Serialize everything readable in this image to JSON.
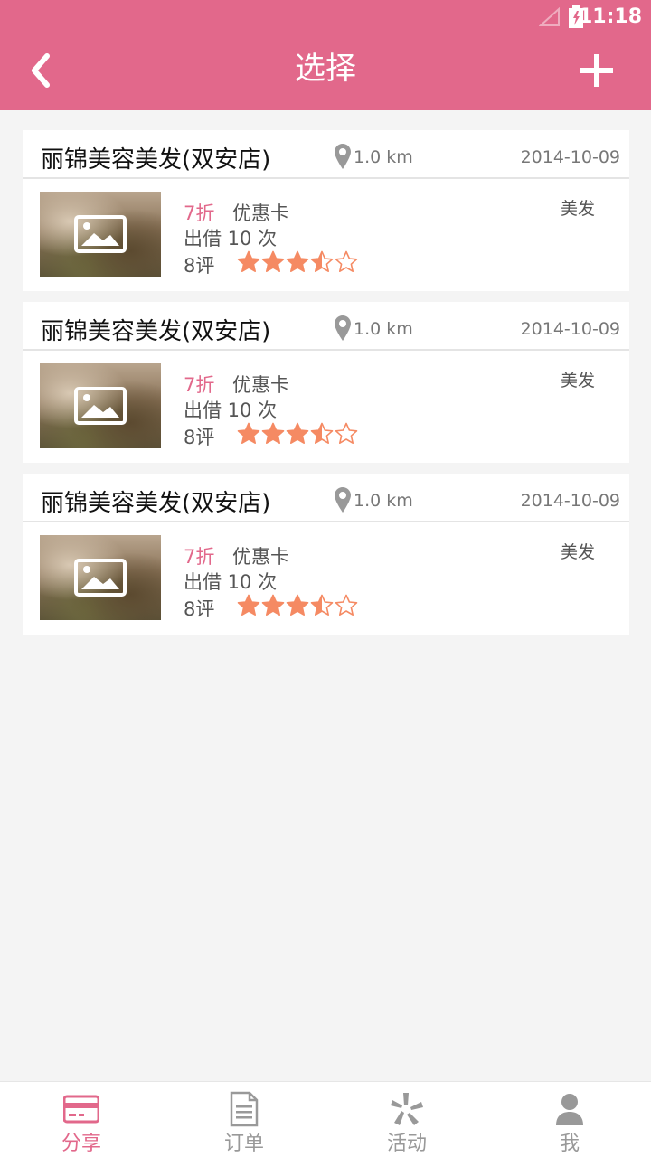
{
  "status": {
    "time": "11:18"
  },
  "header": {
    "title": "选择"
  },
  "colors": {
    "accent": "#e2688b",
    "star": "#f58a63"
  },
  "cards": [
    {
      "name": "丽锦美容美发(双安店)",
      "distance": "1.0 km",
      "date": "2014-10-09",
      "discount": "7折",
      "card_type": "优惠卡",
      "lend": "出借 10 次",
      "reviews": "8评",
      "rating": 3.5,
      "category": "美发"
    },
    {
      "name": "丽锦美容美发(双安店)",
      "distance": "1.0 km",
      "date": "2014-10-09",
      "discount": "7折",
      "card_type": "优惠卡",
      "lend": "出借 10 次",
      "reviews": "8评",
      "rating": 3.5,
      "category": "美发"
    },
    {
      "name": "丽锦美容美发(双安店)",
      "distance": "1.0 km",
      "date": "2014-10-09",
      "discount": "7折",
      "card_type": "优惠卡",
      "lend": "出借 10 次",
      "reviews": "8评",
      "rating": 3.5,
      "category": "美发"
    }
  ],
  "nav": [
    {
      "label": "分享",
      "icon": "card-icon",
      "active": true
    },
    {
      "label": "订单",
      "icon": "document-icon",
      "active": false
    },
    {
      "label": "活动",
      "icon": "activity-icon",
      "active": false
    },
    {
      "label": "我",
      "icon": "person-icon",
      "active": false
    }
  ]
}
